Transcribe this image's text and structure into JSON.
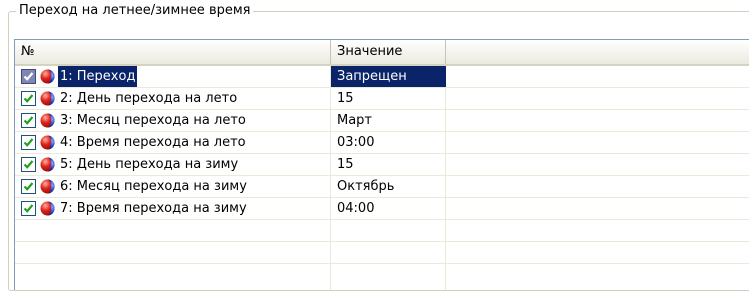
{
  "groupbox": {
    "title": "Переход на летнее/зимнее время"
  },
  "columns": {
    "num": "№",
    "value": "Значение"
  },
  "rows": [
    {
      "name": "1: Переход",
      "value": "Запрещен",
      "checked": true,
      "selected": true
    },
    {
      "name": "2: День перехода на лето",
      "value": "15",
      "checked": true
    },
    {
      "name": "3: Месяц перехода на лето",
      "value": "Март",
      "checked": true
    },
    {
      "name": "4: Время перехода на лето",
      "value": "03:00",
      "checked": true
    },
    {
      "name": "5: День перехода на зиму",
      "value": "15",
      "checked": true
    },
    {
      "name": "6: Месяц перехода на зиму",
      "value": "Октябрь",
      "checked": true
    },
    {
      "name": "7: Время перехода на зиму",
      "value": "04:00",
      "checked": true
    }
  ],
  "colors": {
    "selection": "#0a246a",
    "check": "#21a121",
    "ball_red": "#e0201a",
    "ball_blue": "#1a3fc0"
  }
}
